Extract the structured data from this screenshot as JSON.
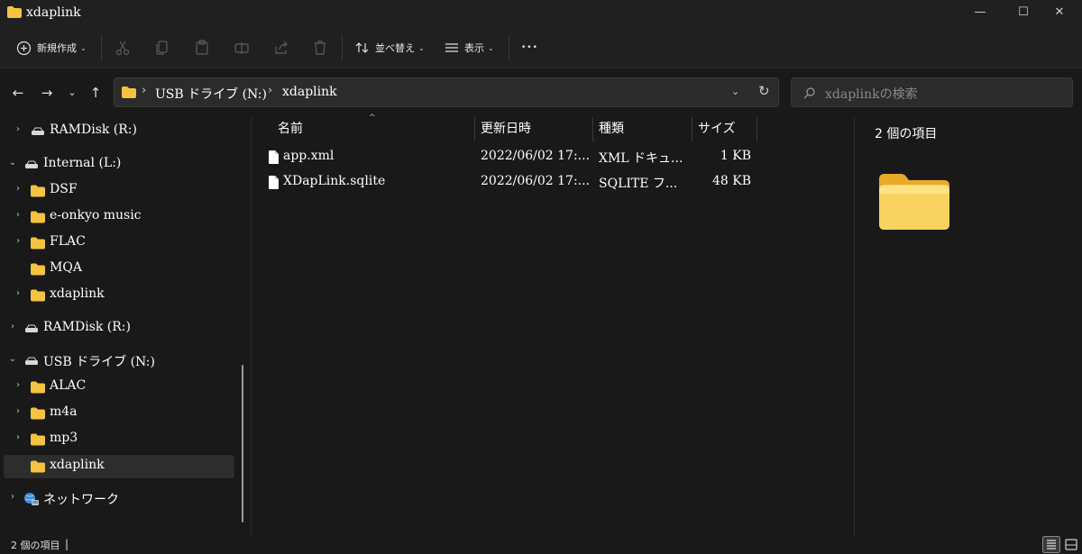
{
  "window": {
    "title": "xdaplink",
    "minimize": "—",
    "maximize": "☐",
    "close": "✕"
  },
  "toolbar": {
    "new_label": "新規作成",
    "sort_label": "並べ替え",
    "view_label": "表示",
    "more_label": "•••",
    "chevron": "⌄"
  },
  "nav": {
    "back": "←",
    "forward": "→",
    "recent": "⌄",
    "up": "↑",
    "dropdown": "⌄",
    "refresh": "↻"
  },
  "address": {
    "sep": "›",
    "crumbs": [
      "USB ドライブ (N:)",
      "xdaplink"
    ]
  },
  "search": {
    "placeholder": "xdaplinkの検索"
  },
  "sidebar": {
    "expand": "›",
    "collapse": "⌄",
    "items": [
      {
        "label": "RAMDisk (R:)"
      },
      {
        "label": "Internal (L:)"
      },
      {
        "label": "DSF"
      },
      {
        "label": "e-onkyo music"
      },
      {
        "label": "FLAC"
      },
      {
        "label": "MQA"
      },
      {
        "label": "xdaplink"
      },
      {
        "label": "RAMDisk (R:)"
      },
      {
        "label": "USB ドライブ (N:)"
      },
      {
        "label": "ALAC"
      },
      {
        "label": "m4a"
      },
      {
        "label": "mp3"
      },
      {
        "label": "xdaplink"
      },
      {
        "label": "ネットワーク"
      }
    ]
  },
  "columns": {
    "name": "名前",
    "modified": "更新日時",
    "type": "種類",
    "size": "サイズ",
    "sort_arrow": "^"
  },
  "files": [
    {
      "name": "app.xml",
      "modified": "2022/06/02 17:...",
      "type": "XML ドキュ...",
      "size": "1 KB"
    },
    {
      "name": "XDapLink.sqlite",
      "modified": "2022/06/02 17:...",
      "type": "SQLITE フ...",
      "size": "48 KB"
    }
  ],
  "details": {
    "count": "2 個の項目"
  },
  "status": {
    "text": "2 個の項目",
    "caret": "|"
  },
  "colors": {
    "folder_yellow": "#f5c342",
    "background": "#191919",
    "chrome": "#202020"
  }
}
